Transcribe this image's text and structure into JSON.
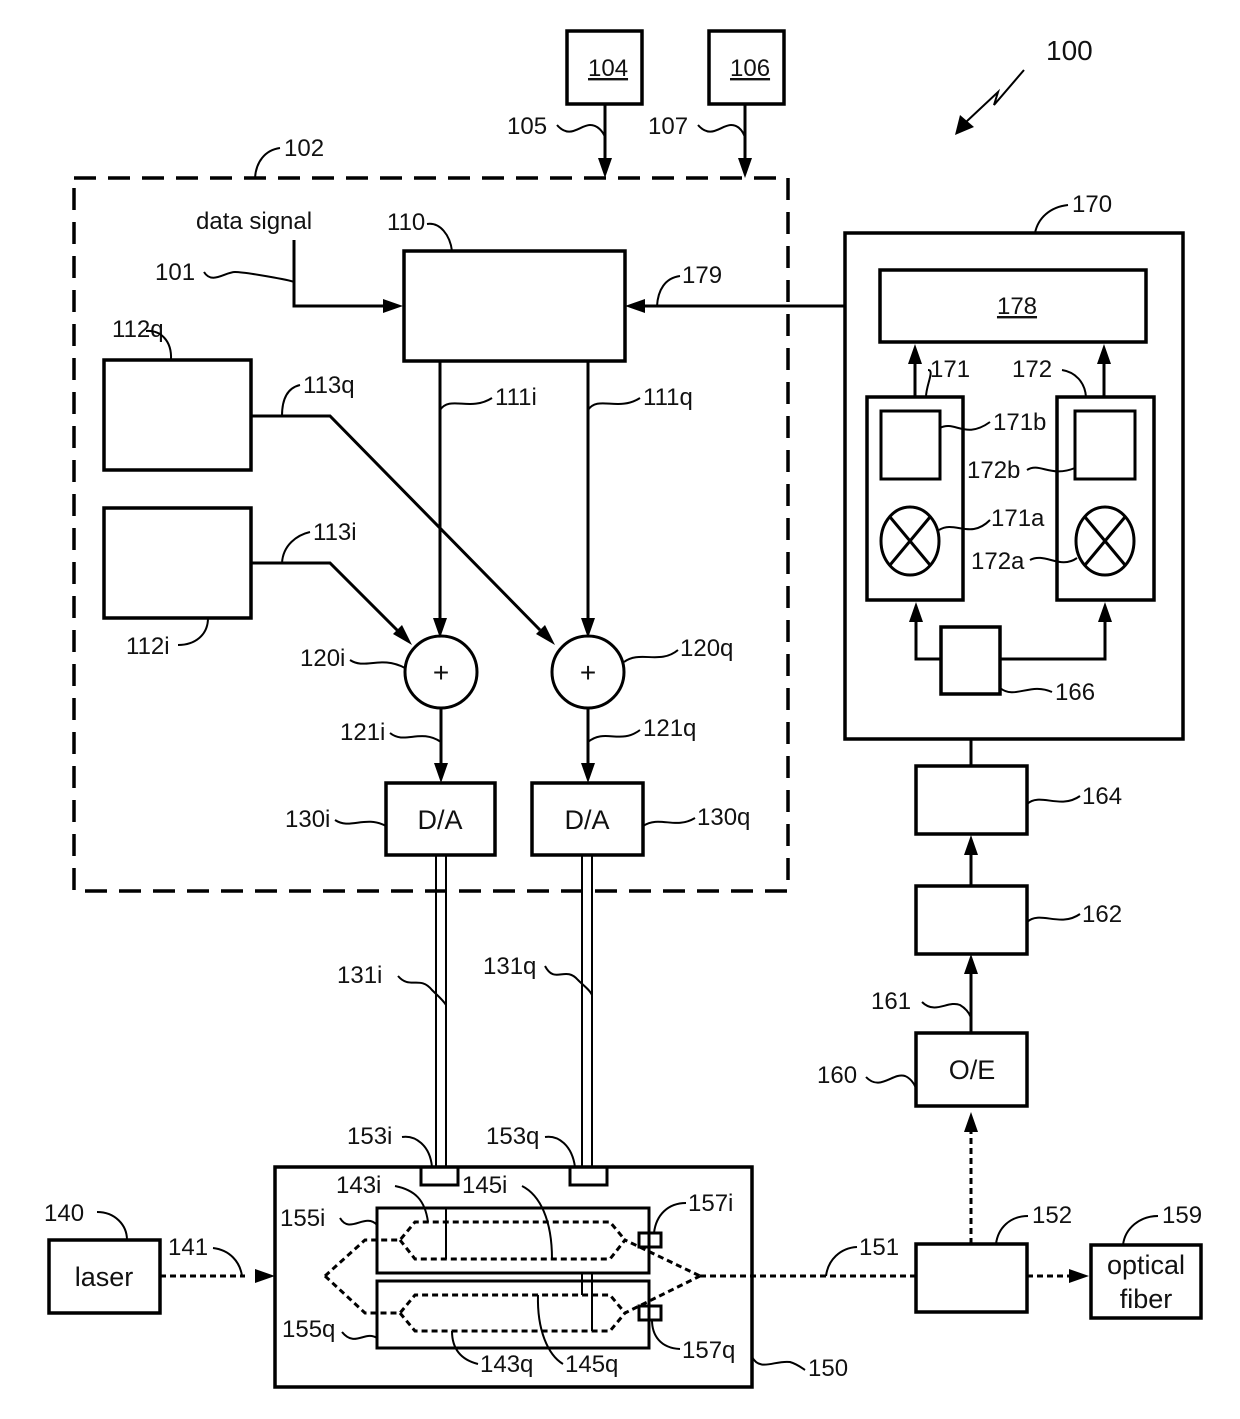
{
  "figure": {
    "number": "100",
    "labels": {
      "r100": "100",
      "r101": "101",
      "r102": "102",
      "r104": "104",
      "r105": "105",
      "r106": "106",
      "r107": "107",
      "r110": "110",
      "r111i": "111i",
      "r111q": "111q",
      "r112q": "112q",
      "r112i": "112i",
      "r113q": "113q",
      "r113i": "113i",
      "r120i": "120i",
      "r120q": "120q",
      "r121i": "121i",
      "r121q": "121q",
      "r130i": "130i",
      "r130q": "130q",
      "r131i": "131i",
      "r131q": "131q",
      "r140": "140",
      "r141": "141",
      "r143i": "143i",
      "r145i": "145i",
      "r143q": "143q",
      "r145q": "145q",
      "r150": "150",
      "r151": "151",
      "r152": "152",
      "r153i": "153i",
      "r153q": "153q",
      "r155i": "155i",
      "r155q": "155q",
      "r157i": "157i",
      "r157q": "157q",
      "r159": "159",
      "r160": "160",
      "r161": "161",
      "r162": "162",
      "r164": "164",
      "r166": "166",
      "r170": "170",
      "r171": "171",
      "r172": "172",
      "r171a": "171a",
      "r171b": "171b",
      "r172a": "172a",
      "r172b": "172b",
      "r178": "178",
      "r179": "179"
    },
    "text": {
      "data_signal": "data signal",
      "da_i": "D/A",
      "da_q": "D/A",
      "laser": "laser",
      "oe": "O/E",
      "optical": "optical",
      "fiber": "fiber",
      "plus": "+"
    }
  }
}
